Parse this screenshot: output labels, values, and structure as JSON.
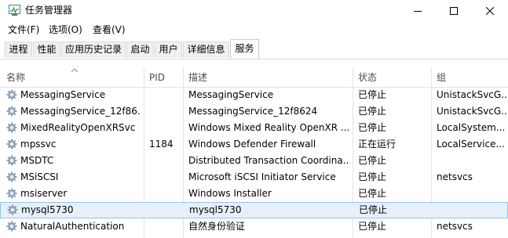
{
  "window": {
    "title": "任务管理器",
    "icon": "task-manager-icon",
    "controls": [
      "minimize-icon",
      "maximize-icon",
      "close-icon"
    ]
  },
  "menu": [
    "文件(F)",
    "选项(O)",
    "查看(V)"
  ],
  "tabs": [
    {
      "label": "进程",
      "active": false
    },
    {
      "label": "性能",
      "active": false
    },
    {
      "label": "应用历史记录",
      "active": false
    },
    {
      "label": "启动",
      "active": false
    },
    {
      "label": "用户",
      "active": false
    },
    {
      "label": "详细信息",
      "active": false
    },
    {
      "label": "服务",
      "active": true
    }
  ],
  "table": {
    "columns": [
      "名称",
      "PID",
      "描述",
      "状态",
      "组"
    ],
    "sorted_column": "名称",
    "row_icon": "gear-icon",
    "rows": [
      {
        "name": "MessagingService",
        "pid": "",
        "description": "MessagingService",
        "status": "已停止",
        "group": "UnistackSvcG..."
      },
      {
        "name": "MessagingService_12f86...",
        "pid": "",
        "description": "MessagingService_12f8624",
        "status": "已停止",
        "group": "UnistackSvcG..."
      },
      {
        "name": "MixedRealityOpenXRSvc",
        "pid": "",
        "description": "Windows Mixed Reality OpenXR ...",
        "status": "已停止",
        "group": "LocalSystem..."
      },
      {
        "name": "mpssvc",
        "pid": "1184",
        "description": "Windows Defender Firewall",
        "status": "正在运行",
        "group": "LocalService..."
      },
      {
        "name": "MSDTC",
        "pid": "",
        "description": "Distributed Transaction Coordina...",
        "status": "已停止",
        "group": ""
      },
      {
        "name": "MSiSCSI",
        "pid": "",
        "description": "Microsoft iSCSI Initiator Service",
        "status": "已停止",
        "group": "netsvcs"
      },
      {
        "name": "msiserver",
        "pid": "",
        "description": "Windows Installer",
        "status": "已停止",
        "group": ""
      },
      {
        "name": "mysql5730",
        "pid": "",
        "description": "mysql5730",
        "status": "已停止",
        "group": "",
        "selected": true
      },
      {
        "name": "NaturalAuthentication",
        "pid": "",
        "description": "自然身份验证",
        "status": "已停止",
        "group": "netsvcs"
      }
    ]
  }
}
